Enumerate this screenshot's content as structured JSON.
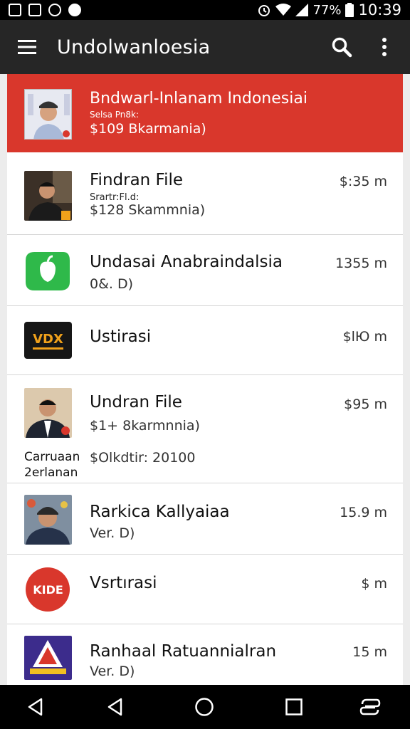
{
  "status": {
    "left_icons": [
      "image-icon",
      "image-icon",
      "alarm-icon",
      "vpn-icon"
    ],
    "battery": "77%",
    "time": "10:39"
  },
  "toolbar": {
    "title": "Undolwanloesia",
    "menu_icon": "hamburger-menu-icon",
    "search_icon": "search-icon",
    "more_icon": "more-vert-icon"
  },
  "featured": {
    "title": "Bndwarl-Inlanam Indonesiai",
    "sub": "Selsa Pn8k:",
    "price": "$109 Bkarmania)",
    "color": "#d9372c"
  },
  "items": [
    {
      "title": "Findran File",
      "sub": "Srartr:Fl.d:",
      "price": "$128 Skammnia)",
      "size": "$:35 m",
      "thumb": "person-thumb"
    },
    {
      "title": "Undasai Anabraindalsia",
      "price": "0&. D)",
      "size": "1355 m",
      "thumb": "green-logo-thumb"
    },
    {
      "title": "Ustirasi",
      "size": "$lЮ m",
      "thumb": "vdx-logo-thumb"
    },
    {
      "title": "Undran File",
      "price": "$1+ 8karmnnia)",
      "size": "$95 m",
      "extra_left": "Carruaan\n2erlanan",
      "extra_right": "$Olkdtir: 20100",
      "thumb": "man-suit-thumb"
    },
    {
      "title": "Rarkica Kallyaiaa",
      "price": "Ver. D)",
      "size": "15.9 m",
      "thumb": "man-cap-thumb"
    },
    {
      "title": "Vsrtırasi",
      "size": "$ m",
      "thumb": "red-badge-thumb",
      "badge_text": "KIDE"
    },
    {
      "title": "Ranhaal Ratuannialran",
      "price": "Ver. D)",
      "size": "15 m",
      "thumb": "purple-logo-thumb"
    }
  ],
  "nav": {
    "icons": [
      "back-icon",
      "back-icon",
      "home-icon",
      "recents-icon",
      "switch-icon"
    ]
  }
}
